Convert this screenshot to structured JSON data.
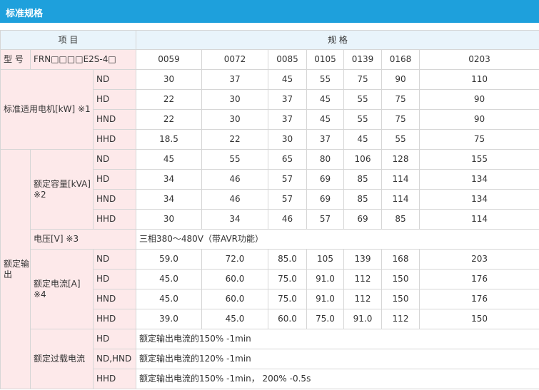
{
  "section_title": "标准规格",
  "table": {
    "header_item": "项 目",
    "header_spec": "规 格",
    "model_label": "型 号",
    "model_code": "FRN□□□□E2S-4□",
    "models": [
      "0059",
      "0072",
      "0085",
      "0105",
      "0139",
      "0168",
      "0203"
    ],
    "motor": {
      "label": "标准适用电机[kW] ※1",
      "rows": [
        {
          "mode": "ND",
          "values": [
            "30",
            "37",
            "45",
            "55",
            "75",
            "90",
            "110"
          ]
        },
        {
          "mode": "HD",
          "values": [
            "22",
            "30",
            "37",
            "45",
            "55",
            "75",
            "90"
          ]
        },
        {
          "mode": "HND",
          "values": [
            "22",
            "30",
            "37",
            "45",
            "55",
            "75",
            "90"
          ]
        },
        {
          "mode": "HHD",
          "values": [
            "18.5",
            "22",
            "30",
            "37",
            "45",
            "55",
            "75"
          ]
        }
      ]
    },
    "rated_output": {
      "label": "额定输出",
      "capacity": {
        "label": "额定容量[kVA] ※2",
        "rows": [
          {
            "mode": "ND",
            "values": [
              "45",
              "55",
              "65",
              "80",
              "106",
              "128",
              "155"
            ]
          },
          {
            "mode": "HD",
            "values": [
              "34",
              "46",
              "57",
              "69",
              "85",
              "114",
              "134"
            ]
          },
          {
            "mode": "HND",
            "values": [
              "34",
              "46",
              "57",
              "69",
              "85",
              "114",
              "134"
            ]
          },
          {
            "mode": "HHD",
            "values": [
              "30",
              "34",
              "46",
              "57",
              "69",
              "85",
              "114"
            ]
          }
        ]
      },
      "voltage": {
        "label": "电压[V] ※3",
        "value": "三相380～480V（带AVR功能）"
      },
      "current": {
        "label": "额定电流[A] ※4",
        "rows": [
          {
            "mode": "ND",
            "values": [
              "59.0",
              "72.0",
              "85.0",
              "105",
              "139",
              "168",
              "203"
            ]
          },
          {
            "mode": "HD",
            "values": [
              "45.0",
              "60.0",
              "75.0",
              "91.0",
              "112",
              "150",
              "176"
            ]
          },
          {
            "mode": "HND",
            "values": [
              "45.0",
              "60.0",
              "75.0",
              "91.0",
              "112",
              "150",
              "176"
            ]
          },
          {
            "mode": "HHD",
            "values": [
              "39.0",
              "45.0",
              "60.0",
              "75.0",
              "91.0",
              "112",
              "150"
            ]
          }
        ]
      },
      "overload": {
        "label": "额定过载电流",
        "rows": [
          {
            "mode": "HD",
            "value": "额定输出电流的150% -1min"
          },
          {
            "mode": "ND,HND",
            "value": "额定输出电流的120% -1min"
          },
          {
            "mode": "HHD",
            "value": "额定输出电流的150% -1min， 200% -0.5s"
          }
        ]
      }
    }
  }
}
